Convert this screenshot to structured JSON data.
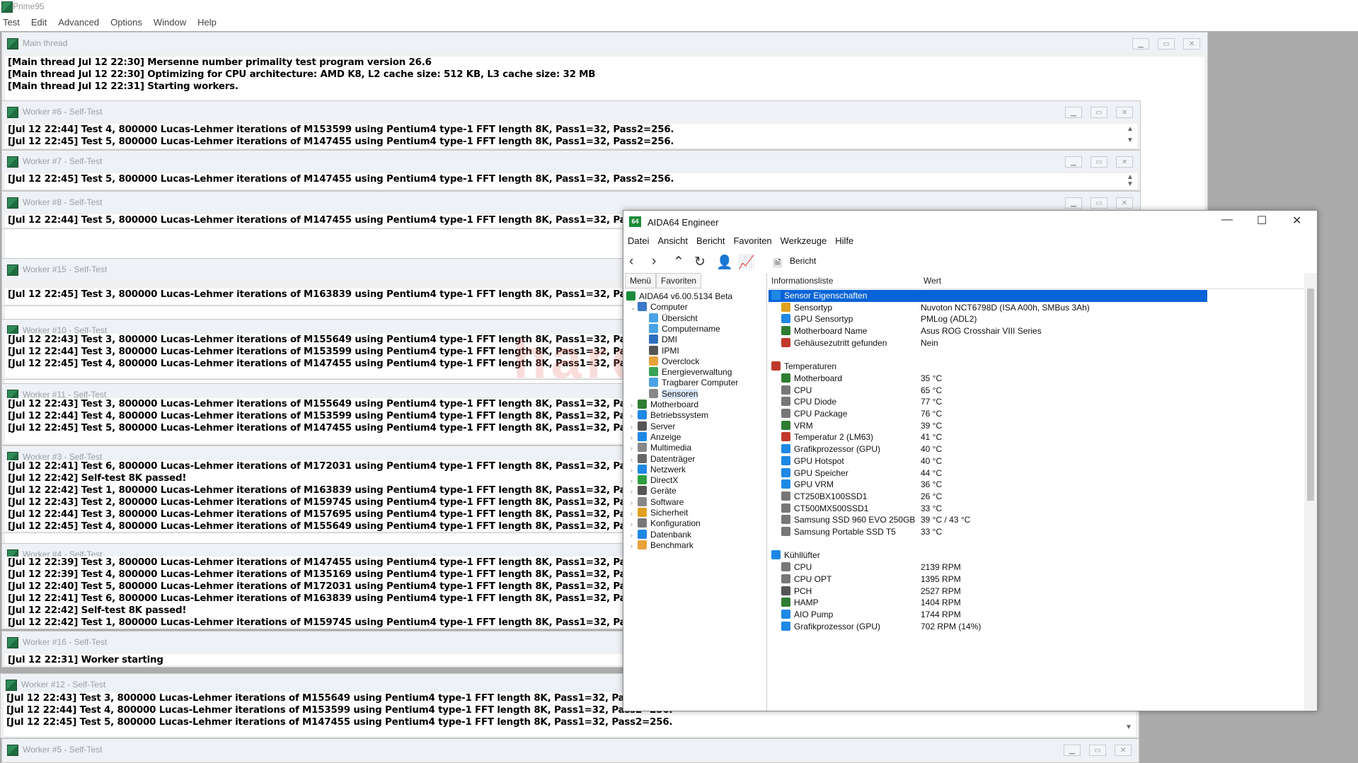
{
  "prime95": {
    "title": "Prime95",
    "menu": [
      "Test",
      "Edit",
      "Advanced",
      "Options",
      "Window",
      "Help"
    ],
    "windows": [
      {
        "title": "Main thread",
        "lines": [
          "[Main thread Jul 12 22:30] Mersenne number primality test program version 26.6",
          "[Main thread Jul 12 22:30] Optimizing for CPU architecture: AMD K8, L2 cache size: 512 KB, L3 cache size: 32 MB",
          "[Main thread Jul 12 22:31] Starting workers."
        ]
      },
      {
        "title": "Worker #6 - Self-Test",
        "lines": [
          "[Jul 12 22:44] Test 4, 800000 Lucas-Lehmer iterations of M153599 using Pentium4 type-1 FFT length 8K, Pass1=32, Pass2=256.",
          "[Jul 12 22:45] Test 5, 800000 Lucas-Lehmer iterations of M147455 using Pentium4 type-1 FFT length 8K, Pass1=32, Pass2=256."
        ]
      },
      {
        "title": "Worker #7 - Self-Test",
        "lines": [
          "[Jul 12 22:45] Test 5, 800000 Lucas-Lehmer iterations of M147455 using Pentium4 type-1 FFT length 8K, Pass1=32, Pass2=256."
        ]
      },
      {
        "title": "Worker #8 - Self-Test",
        "lines": [
          "[Jul 12 22:44] Test 5, 800000 Lucas-Lehmer iterations of M147455 using Pentium4 type-1 FFT length 8K, Pass1=32, Pass2=256."
        ]
      },
      {
        "title": "Worker #15 - Self-Test",
        "lines": [
          "[Jul 12 22:45] Test 3, 800000 Lucas-Lehmer iterations of M163839 using Pentium4 type-1 FFT length 8K, Pass1=32, Pass2=256."
        ]
      },
      {
        "title": "Worker #10 - Self-Test",
        "lines": [
          "[Jul 12 22:43] Test 3, 800000 Lucas-Lehmer iterations of M155649 using Pentium4 type-1 FFT length 8K, Pass1=32, Pass2=256.",
          "[Jul 12 22:44] Test 3, 800000 Lucas-Lehmer iterations of M153599 using Pentium4 type-1 FFT length 8K, Pass1=32, Pass2=256.",
          "[Jul 12 22:45] Test 4, 800000 Lucas-Lehmer iterations of M147455 using Pentium4 type-1 FFT length 8K, Pass1=32, Pass2=256."
        ]
      },
      {
        "title": "Worker #11 - Self-Test",
        "lines": [
          "[Jul 12 22:43] Test 3, 800000 Lucas-Lehmer iterations of M155649 using Pentium4 type-1 FFT length 8K, Pass1=32, Pass2=256.",
          "[Jul 12 22:44] Test 4, 800000 Lucas-Lehmer iterations of M153599 using Pentium4 type-1 FFT length 8K, Pass1=32, Pass2=256.",
          "[Jul 12 22:45] Test 5, 800000 Lucas-Lehmer iterations of M147455 using Pentium4 type-1 FFT length 8K, Pass1=32, Pass2=256."
        ]
      },
      {
        "title": "Worker #3 - Self-Test",
        "lines": [
          "[Jul 12 22:41] Test 6, 800000 Lucas-Lehmer iterations of M172031 using Pentium4 type-1 FFT length 8K, Pass1=32, Pass2=256.",
          "[Jul 12 22:42] Self-test 8K passed!",
          "[Jul 12 22:42] Test 1, 800000 Lucas-Lehmer iterations of M163839 using Pentium4 type-1 FFT length 8K, Pass1=32, Pass2=256.",
          "[Jul 12 22:43] Test 2, 800000 Lucas-Lehmer iterations of M159745 using Pentium4 type-1 FFT length 8K, Pass1=32, Pass2=256.",
          "[Jul 12 22:44] Test 3, 800000 Lucas-Lehmer iterations of M157695 using Pentium4 type-1 FFT length 8K, Pass1=32, Pass2=256.",
          "[Jul 12 22:45] Test 4, 800000 Lucas-Lehmer iterations of M155649 using Pentium4 type-1 FFT length 8K, Pass1=32, Pass2=256."
        ]
      },
      {
        "title": "Worker #4 - Self-Test",
        "lines": [
          "[Jul 12 22:39] Test 3, 800000 Lucas-Lehmer iterations of M147455 using Pentium4 type-1 FFT length 8K, Pass1=32, Pass2=256.",
          "[Jul 12 22:39] Test 4, 800000 Lucas-Lehmer iterations of M135169 using Pentium4 type-1 FFT length 8K, Pass1=32, Pass2=256.",
          "[Jul 12 22:40] Test 5, 800000 Lucas-Lehmer iterations of M172031 using Pentium4 type-1 FFT length 8K, Pass1=32, Pass2=256.",
          "[Jul 12 22:41] Test 6, 800000 Lucas-Lehmer iterations of M163839 using Pentium4 type-1 FFT length 8K, Pass1=32, Pass2=256.",
          "[Jul 12 22:42] Self-test 8K passed!",
          "[Jul 12 22:42] Test 1, 800000 Lucas-Lehmer iterations of M159745 using Pentium4 type-1 FFT length 8K, Pass1=32, Pass2=256."
        ]
      },
      {
        "title": "Worker #16 - Self-Test",
        "lines": [
          "[Jul 12 22:31] Worker starting"
        ]
      },
      {
        "title": "Worker #12 - Self-Test",
        "lines": [
          "[Jul 12 22:43] Test 3, 800000 Lucas-Lehmer iterations of M155649 using Pentium4 type-1 FFT length 8K, Pass1=32, Pass2=256.",
          "[Jul 12 22:44] Test 4, 800000 Lucas-Lehmer iterations of M153599 using Pentium4 type-1 FFT length 8K, Pass1=32, Pass2=256.",
          "[Jul 12 22:45] Test 5, 800000 Lucas-Lehmer iterations of M147455 using Pentium4 type-1 FFT length 8K, Pass1=32, Pass2=256."
        ]
      },
      {
        "title": "Worker #5 - Self-Test",
        "lines": []
      }
    ]
  },
  "aida": {
    "title": "AIDA64 Engineer",
    "menu": [
      "Datei",
      "Ansicht",
      "Bericht",
      "Favoriten",
      "Werkzeuge",
      "Hilfe"
    ],
    "toolbar_report": "Bericht",
    "tabs": [
      "Menü",
      "Favoriten"
    ],
    "tree": [
      {
        "label": "AIDA64 v6.00.5134 Beta",
        "level": 0,
        "icon": "aida-logo-icon",
        "color": "#1a8b3a"
      },
      {
        "label": "Computer",
        "level": 1,
        "icon": "computer-icon",
        "color": "#3a78c9",
        "expanded": true
      },
      {
        "label": "Übersicht",
        "level": 2,
        "icon": "summary-icon",
        "color": "#4aa3e6"
      },
      {
        "label": "Computername",
        "level": 2,
        "icon": "computer-name-icon",
        "color": "#4aa3e6"
      },
      {
        "label": "DMI",
        "level": 2,
        "icon": "dmi-icon",
        "color": "#2e6fbf"
      },
      {
        "label": "IPMI",
        "level": 2,
        "icon": "ipmi-icon",
        "color": "#555555"
      },
      {
        "label": "Overclock",
        "level": 2,
        "icon": "overclock-icon",
        "color": "#e8a23a"
      },
      {
        "label": "Energieverwaltung",
        "level": 2,
        "icon": "power-icon",
        "color": "#3aa35a"
      },
      {
        "label": "Tragbarer Computer",
        "level": 2,
        "icon": "laptop-icon",
        "color": "#4aa3e6"
      },
      {
        "label": "Sensoren",
        "level": 2,
        "icon": "sensor-icon",
        "color": "#888888",
        "selected": true
      },
      {
        "label": "Motherboard",
        "level": 1,
        "icon": "motherboard-icon",
        "color": "#2e7d32",
        "collapsed": true
      },
      {
        "label": "Betriebssystem",
        "level": 1,
        "icon": "windows-icon",
        "color": "#1e88e5",
        "collapsed": true
      },
      {
        "label": "Server",
        "level": 1,
        "icon": "server-icon",
        "color": "#555555",
        "collapsed": true
      },
      {
        "label": "Anzeige",
        "level": 1,
        "icon": "display-icon",
        "color": "#1e88e5",
        "collapsed": true
      },
      {
        "label": "Multimedia",
        "level": 1,
        "icon": "multimedia-icon",
        "color": "#888888",
        "collapsed": true
      },
      {
        "label": "Datenträger",
        "level": 1,
        "icon": "storage-icon",
        "color": "#666666",
        "collapsed": true
      },
      {
        "label": "Netzwerk",
        "level": 1,
        "icon": "network-icon",
        "color": "#1e88e5",
        "collapsed": true
      },
      {
        "label": "DirectX",
        "level": 1,
        "icon": "directx-icon",
        "color": "#2e9e3e",
        "collapsed": true
      },
      {
        "label": "Geräte",
        "level": 1,
        "icon": "devices-icon",
        "color": "#555555",
        "collapsed": true
      },
      {
        "label": "Software",
        "level": 1,
        "icon": "software-icon",
        "color": "#888888",
        "collapsed": true
      },
      {
        "label": "Sicherheit",
        "level": 1,
        "icon": "security-icon",
        "color": "#e0a020",
        "collapsed": true
      },
      {
        "label": "Konfiguration",
        "level": 1,
        "icon": "config-icon",
        "color": "#777777",
        "collapsed": true
      },
      {
        "label": "Datenbank",
        "level": 1,
        "icon": "database-icon",
        "color": "#1e88e5",
        "collapsed": true
      },
      {
        "label": "Benchmark",
        "level": 1,
        "icon": "benchmark-icon",
        "color": "#e8a23a",
        "collapsed": true
      }
    ],
    "columns": [
      "Informationsliste",
      "Wert"
    ],
    "rows": [
      {
        "type": "section",
        "key": "Sensor Eigenschaften",
        "icon": "sensor-props-icon",
        "color": "#1e88e5",
        "selected": true
      },
      {
        "type": "item",
        "key": "Sensortyp",
        "value": "Nuvoton NCT6798D  (ISA A00h, SMBus 3Ah)",
        "icon": "sensor-icon",
        "color": "#e0a020"
      },
      {
        "type": "item",
        "key": "GPU Sensortyp",
        "value": "PMLog  (ADL2)",
        "icon": "gpu-icon",
        "color": "#1e88e5"
      },
      {
        "type": "item",
        "key": "Motherboard Name",
        "value": "Asus ROG Crosshair VIII Series",
        "icon": "motherboard-icon",
        "color": "#2e7d32"
      },
      {
        "type": "item",
        "key": "Gehäusezutritt gefunden",
        "value": "Nein",
        "icon": "shield-icon",
        "color": "#c0392b"
      },
      {
        "type": "blank"
      },
      {
        "type": "section",
        "key": "Temperaturen",
        "icon": "thermometer-icon",
        "color": "#c0392b"
      },
      {
        "type": "item",
        "key": "Motherboard",
        "value": "35 °C",
        "icon": "motherboard-icon",
        "color": "#2e7d32"
      },
      {
        "type": "item",
        "key": "CPU",
        "value": "65 °C",
        "icon": "cpu-icon",
        "color": "#777777"
      },
      {
        "type": "item",
        "key": "CPU Diode",
        "value": "77 °C",
        "icon": "cpu-icon",
        "color": "#777777"
      },
      {
        "type": "item",
        "key": "CPU Package",
        "value": "76 °C",
        "icon": "cpu-icon",
        "color": "#777777"
      },
      {
        "type": "item",
        "key": "VRM",
        "value": "39 °C",
        "icon": "vrm-icon",
        "color": "#2e7d32"
      },
      {
        "type": "item",
        "key": "Temperatur 2 (LM63)",
        "value": "41 °C",
        "icon": "thermometer-icon",
        "color": "#c0392b"
      },
      {
        "type": "item",
        "key": "Grafikprozessor (GPU)",
        "value": "40 °C",
        "icon": "gpu-icon",
        "color": "#1e88e5"
      },
      {
        "type": "item",
        "key": "GPU Hotspot",
        "value": "40 °C",
        "icon": "gpu-icon",
        "color": "#1e88e5"
      },
      {
        "type": "item",
        "key": "GPU Speicher",
        "value": "44 °C",
        "icon": "gpu-icon",
        "color": "#1e88e5"
      },
      {
        "type": "item",
        "key": "GPU VRM",
        "value": "36 °C",
        "icon": "gpu-icon",
        "color": "#1e88e5"
      },
      {
        "type": "item",
        "key": "CT250BX100SSD1",
        "value": "26 °C",
        "icon": "drive-icon",
        "color": "#777777"
      },
      {
        "type": "item",
        "key": "CT500MX500SSD1",
        "value": "33 °C",
        "icon": "drive-icon",
        "color": "#777777"
      },
      {
        "type": "item",
        "key": "Samsung SSD 960 EVO 250GB",
        "value": "39 °C / 43 °C",
        "icon": "drive-icon",
        "color": "#777777"
      },
      {
        "type": "item",
        "key": "Samsung Portable SSD T5",
        "value": "33 °C",
        "icon": "drive-icon",
        "color": "#777777"
      },
      {
        "type": "blank"
      },
      {
        "type": "section",
        "key": "Kühllüfter",
        "icon": "fan-icon",
        "color": "#1e88e5"
      },
      {
        "type": "item",
        "key": "CPU",
        "value": "2139 RPM",
        "icon": "cpu-icon",
        "color": "#777777"
      },
      {
        "type": "item",
        "key": "CPU OPT",
        "value": "1395 RPM",
        "icon": "cpu-icon",
        "color": "#777777"
      },
      {
        "type": "item",
        "key": "PCH",
        "value": "2527 RPM",
        "icon": "chip-icon",
        "color": "#555555"
      },
      {
        "type": "item",
        "key": "HAMP",
        "value": "1404 RPM",
        "icon": "vrm-icon",
        "color": "#2e7d32"
      },
      {
        "type": "item",
        "key": "AIO Pump",
        "value": "1744 RPM",
        "icon": "fan-icon",
        "color": "#1e88e5"
      },
      {
        "type": "item",
        "key": "Grafikprozessor (GPU)",
        "value": "702 RPM  (14%)",
        "icon": "gpu-icon",
        "color": "#1e88e5"
      }
    ]
  },
  "watermark": "hardware inside"
}
